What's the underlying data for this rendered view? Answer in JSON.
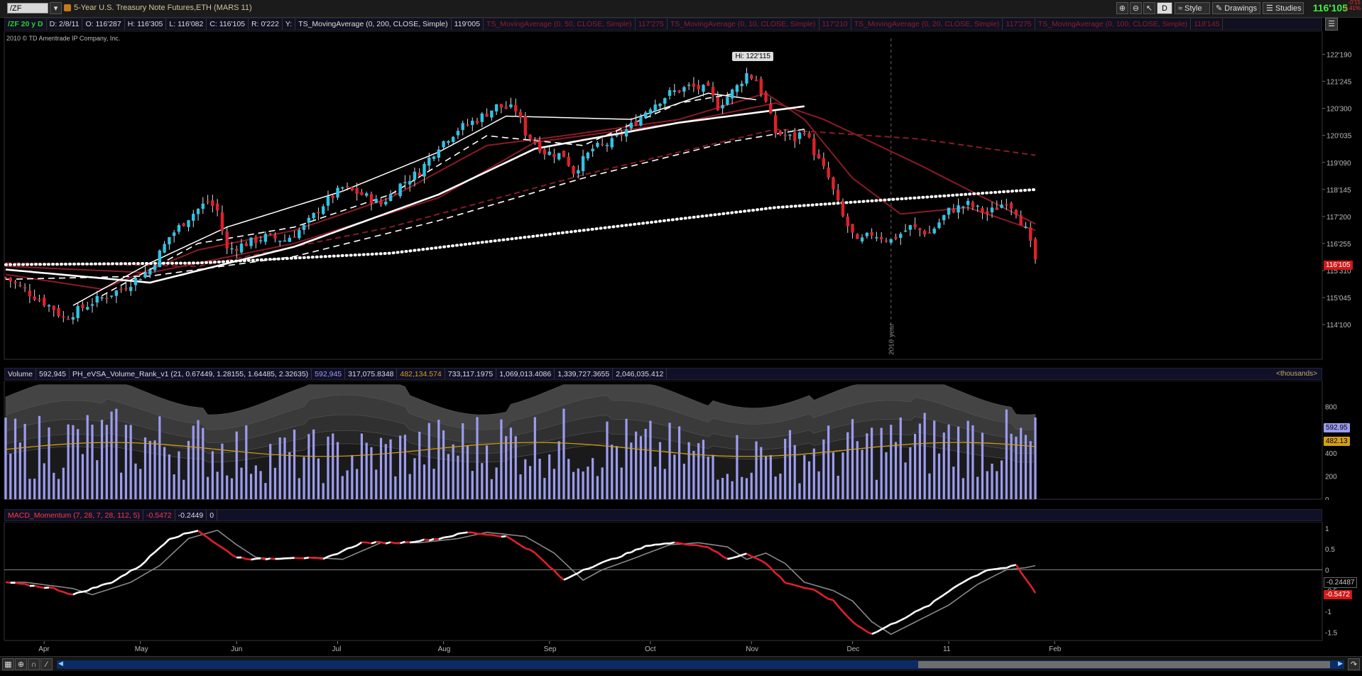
{
  "toolbar": {
    "symbol": "/ZF",
    "title": "5-Year U.S. Treasury Note Futures,ETH (MARS 11)",
    "period_button": "D",
    "style_label": "Style",
    "drawings_label": "Drawings",
    "studies_label": "Studies",
    "last_price": "116'105",
    "change_1": "-0'15",
    "change_2": "-0.41%"
  },
  "infobar": {
    "symbol_period": "/ZF 20 y D",
    "date": "D: 2/8/11",
    "open": "O: 116'287",
    "high": "H: 116'305",
    "low": "L: 116'082",
    "close": "C: 116'105",
    "range": "R: 0'222",
    "y_label": "Y:",
    "ma1_name": "TS_MovingAverage (0, 200, CLOSE, Simple)",
    "ma1_val": "119'005",
    "ma2_name": "TS_MovingAverage (0, 50, CLOSE, Simple)",
    "ma2_val": "117'275",
    "ma3_name": "TS_MovingAverage (0, 10, CLOSE, Simple)",
    "ma3_val": "117'210",
    "ma4_name": "TS_MovingAverage (0, 20, CLOSE, Simple)",
    "ma4_val": "117'275",
    "ma5_name": "TS_MovingAverage (0, 100, CLOSE, Simple)",
    "ma5_val": "118'145"
  },
  "copyright": "2010 © TD Ameritrade IP Company, Inc.",
  "hi_label": "Hi: 122'115",
  "year_marker": "2010 year",
  "price_tag": "116'105",
  "volume_bar": {
    "label": "Volume",
    "value": "592,945",
    "study": "PH_eVSA_Volume_Rank_v1 (21, 0.67449, 1.28155, 1.64485, 2.32635)",
    "v1": "592,945",
    "v2": "317,075.8348",
    "v3": "482,134.574",
    "v4": "733,117.1975",
    "v5": "1,069,013.4086",
    "v6": "1,339,727.3655",
    "v7": "2,046,035.412",
    "units": "<thousands>",
    "tag_volume": "592.95",
    "tag_avg": "482.13"
  },
  "macd_bar": {
    "study": "MACD_Momentum (7, 28, 7, 28, 112, 5)",
    "v1": "-0.5472",
    "v2": "-0.2449",
    "v3": "0",
    "tag_signal": "-0.24487",
    "tag_macd": "-0.5472"
  },
  "colors": {
    "up_candle": "#2ec4e6",
    "down_candle": "#e0202a",
    "volume": "#9c9cf2",
    "volume_avg": "#d4a017",
    "macd_up": "#ffffff",
    "macd_down": "#e0202a",
    "signal": "#888888",
    "ma_dark_red": "#8b1a26"
  },
  "chart_data": [
    {
      "type": "candlestick",
      "name": "price",
      "x_labels": [
        "Apr",
        "May",
        "Jun",
        "Jul",
        "Aug",
        "Sep",
        "Oct",
        "Nov",
        "Dec",
        "11",
        "Feb"
      ],
      "y_ticks": [
        "122'190",
        "121'245",
        "120'300",
        "120'035",
        "119'090",
        "118'145",
        "117'200",
        "116'255",
        "115'310",
        "115'045",
        "114'100"
      ],
      "y_tick_values": [
        122.594,
        121.766,
        120.938,
        120.109,
        119.281,
        118.453,
        117.625,
        116.797,
        115.969,
        115.141,
        114.313
      ],
      "ylim": [
        113.25,
        123.3
      ],
      "bars_count": 215,
      "close_path": [
        [
          0,
          115.75
        ],
        [
          10,
          114.8
        ],
        [
          12,
          114.5
        ],
        [
          18,
          115.0
        ],
        [
          24,
          115.4
        ],
        [
          30,
          116.0
        ],
        [
          34,
          117.0
        ],
        [
          38,
          117.6
        ],
        [
          42,
          118.1
        ],
        [
          44,
          117.8
        ],
        [
          46,
          116.6
        ],
        [
          50,
          116.8
        ],
        [
          54,
          117.0
        ],
        [
          58,
          116.9
        ],
        [
          62,
          117.3
        ],
        [
          66,
          118.0
        ],
        [
          70,
          118.5
        ],
        [
          74,
          118.3
        ],
        [
          78,
          118.0
        ],
        [
          82,
          118.6
        ],
        [
          86,
          119.0
        ],
        [
          90,
          119.8
        ],
        [
          94,
          120.3
        ],
        [
          98,
          120.6
        ],
        [
          102,
          121.0
        ],
        [
          106,
          120.9
        ],
        [
          108,
          120.2
        ],
        [
          112,
          119.6
        ],
        [
          116,
          119.5
        ],
        [
          118,
          119.0
        ],
        [
          122,
          119.7
        ],
        [
          126,
          119.9
        ],
        [
          130,
          120.4
        ],
        [
          134,
          121.0
        ],
        [
          138,
          121.4
        ],
        [
          142,
          121.6
        ],
        [
          146,
          121.5
        ],
        [
          148,
          121.0
        ],
        [
          152,
          121.6
        ],
        [
          154,
          122.0
        ],
        [
          156,
          121.8
        ],
        [
          158,
          121.1
        ],
        [
          160,
          120.2
        ],
        [
          164,
          120.0
        ],
        [
          166,
          120.3
        ],
        [
          168,
          119.6
        ],
        [
          171,
          118.8
        ],
        [
          174,
          117.6
        ],
        [
          177,
          116.8
        ],
        [
          180,
          117.1
        ],
        [
          184,
          116.9
        ],
        [
          188,
          117.3
        ],
        [
          192,
          117.1
        ],
        [
          196,
          117.8
        ],
        [
          200,
          118.0
        ],
        [
          204,
          117.7
        ],
        [
          208,
          118.1
        ],
        [
          210,
          117.8
        ],
        [
          212,
          117.2
        ],
        [
          214,
          116.3
        ]
      ],
      "moving_averages": [
        {
          "name": "TS_MovingAverage (0, 200, CLOSE, Simple)",
          "style": "dotted-white",
          "points": [
            [
              0,
              116.15
            ],
            [
              40,
              116.2
            ],
            [
              80,
              116.5
            ],
            [
              120,
              117.2
            ],
            [
              160,
              117.9
            ],
            [
              214,
              118.45
            ]
          ]
        },
        {
          "name": "TS_MovingAverage (0, 100, CLOSE, Simple)",
          "style": "dashed-white",
          "points": [
            [
              0,
              115.7
            ],
            [
              30,
              115.8
            ],
            [
              60,
              116.4
            ],
            [
              90,
              117.5
            ],
            [
              120,
              118.8
            ],
            [
              150,
              119.9
            ],
            [
              166,
              120.3
            ]
          ]
        },
        {
          "name": "TS_MovingAverage (0, 50, CLOSE, Simple)",
          "style": "solid-white-thick",
          "points": [
            [
              0,
              116.0
            ],
            [
              30,
              115.6
            ],
            [
              60,
              116.7
            ],
            [
              90,
              118.3
            ],
            [
              110,
              119.7
            ],
            [
              140,
              120.5
            ],
            [
              166,
              121.0
            ]
          ]
        },
        {
          "name": "TS_MovingAverage (0, 20, CLOSE, Simple)",
          "style": "dashed-white",
          "points": [
            [
              20,
              115.2
            ],
            [
              40,
              116.8
            ],
            [
              60,
              117.3
            ],
            [
              80,
              118.3
            ],
            [
              100,
              120.1
            ],
            [
              120,
              119.8
            ],
            [
              140,
              121.1
            ],
            [
              152,
              121.4
            ]
          ]
        },
        {
          "name": "TS_MovingAverage (0, 10, CLOSE, Simple)",
          "style": "solid-white",
          "points": [
            [
              14,
              114.9
            ],
            [
              30,
              116.2
            ],
            [
              46,
              117.3
            ],
            [
              70,
              118.4
            ],
            [
              90,
              119.6
            ],
            [
              104,
              120.7
            ],
            [
              130,
              120.6
            ],
            [
              146,
              121.4
            ],
            [
              156,
              121.2
            ]
          ]
        }
      ]
    },
    {
      "type": "bar",
      "name": "volume",
      "y_ticks": [
        0,
        200,
        400,
        600,
        800
      ],
      "ylim": [
        0,
        1000
      ],
      "bars_count": 215,
      "last_value": 592.95,
      "average_last": 482.13
    },
    {
      "type": "line",
      "name": "macd",
      "y_ticks": [
        "1",
        "0.5",
        "0",
        "-0.5",
        "-1",
        "-1.5"
      ],
      "y_tick_values": [
        1,
        0.5,
        0,
        -0.5,
        -1,
        -1.5
      ],
      "ylim": [
        -1.7,
        1.15
      ],
      "macd_path": [
        [
          0,
          -0.3
        ],
        [
          10,
          -0.45
        ],
        [
          14,
          -0.6
        ],
        [
          22,
          -0.3
        ],
        [
          28,
          0.1
        ],
        [
          34,
          0.75
        ],
        [
          40,
          0.95
        ],
        [
          44,
          0.6
        ],
        [
          48,
          0.3
        ],
        [
          52,
          0.25
        ],
        [
          60,
          0.3
        ],
        [
          66,
          0.25
        ],
        [
          74,
          0.65
        ],
        [
          82,
          0.65
        ],
        [
          90,
          0.75
        ],
        [
          96,
          0.9
        ],
        [
          104,
          0.8
        ],
        [
          110,
          0.4
        ],
        [
          116,
          -0.25
        ],
        [
          120,
          0.0
        ],
        [
          126,
          0.25
        ],
        [
          134,
          0.6
        ],
        [
          140,
          0.65
        ],
        [
          146,
          0.55
        ],
        [
          150,
          0.25
        ],
        [
          154,
          0.4
        ],
        [
          158,
          0.15
        ],
        [
          162,
          -0.3
        ],
        [
          168,
          -0.5
        ],
        [
          172,
          -0.75
        ],
        [
          176,
          -1.25
        ],
        [
          180,
          -1.55
        ],
        [
          186,
          -1.2
        ],
        [
          192,
          -0.85
        ],
        [
          198,
          -0.35
        ],
        [
          204,
          0.0
        ],
        [
          208,
          0.05
        ],
        [
          210,
          0.1
        ],
        [
          214,
          -0.55
        ]
      ],
      "signal_last": -0.24487,
      "macd_last": -0.5472
    }
  ]
}
